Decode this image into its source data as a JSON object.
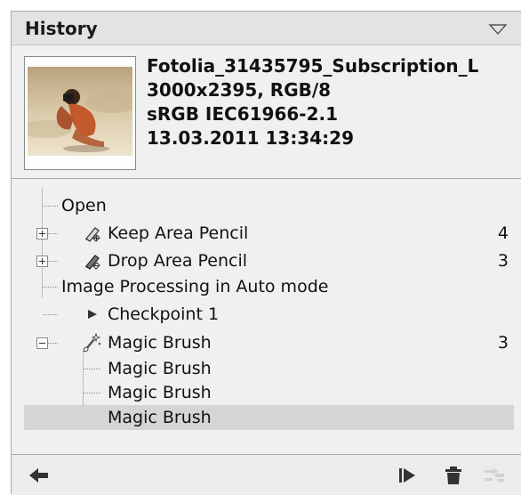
{
  "panel": {
    "title": "History",
    "collapse_icon": "triangle-down-icon"
  },
  "image_info": {
    "thumbnail_icon": "photo-thumbnail",
    "filename": "Fotolia_31435795_Subscription_L",
    "dimensions": "3000x2395, RGB/8",
    "color_profile": "sRGB IEC61966-2.1",
    "datetime": "13.03.2011 13:34:29"
  },
  "history": {
    "items": [
      {
        "label": "Open",
        "count": "",
        "icon": "",
        "expander": ""
      },
      {
        "label": "Keep Area Pencil",
        "count": "4",
        "icon": "keep-pencil-icon",
        "expander": "plus"
      },
      {
        "label": "Drop Area Pencil",
        "count": "3",
        "icon": "drop-pencil-icon",
        "expander": "plus"
      },
      {
        "label": "Image Processing in Auto mode",
        "count": "",
        "icon": "",
        "expander": ""
      },
      {
        "label": "Checkpoint 1",
        "count": "",
        "icon": "play-triangle-icon",
        "expander": ""
      },
      {
        "label": "Magic Brush",
        "count": "3",
        "icon": "magic-brush-icon",
        "expander": "minus"
      },
      {
        "label": "Magic Brush",
        "count": "",
        "icon": "",
        "expander": ""
      },
      {
        "label": "Magic Brush",
        "count": "",
        "icon": "",
        "expander": ""
      },
      {
        "label": "Magic Brush",
        "count": "",
        "icon": "",
        "expander": "",
        "selected": true
      }
    ]
  },
  "footer": {
    "undo_icon": "back-arrow-icon",
    "checkpoint_icon": "flag-play-icon",
    "delete_icon": "trash-icon",
    "disabled_icon": "merge-disabled-icon"
  },
  "colors": {
    "panel_bg": "#f0f0f0",
    "header_bg": "#e3e3e3",
    "selected_row": "#d5d5d5",
    "icon_dark": "#333333",
    "icon_disabled": "#d2d2d2"
  }
}
